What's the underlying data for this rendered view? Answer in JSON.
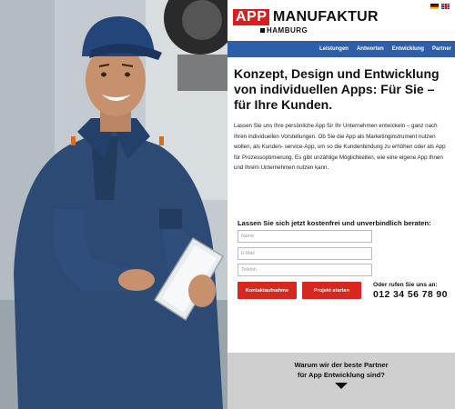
{
  "brand": {
    "logo_app": "APP",
    "logo_main": "MANUFAKTUR",
    "logo_sub": "HAMBURG"
  },
  "language_flags": [
    "flag-de-icon",
    "flag-en-icon"
  ],
  "nav": {
    "items": [
      {
        "label": "Leistungen"
      },
      {
        "label": "Antworten"
      },
      {
        "label": "Entwicklung"
      },
      {
        "label": "Partner"
      }
    ]
  },
  "hero": {
    "headline": "Konzept, Design und Entwicklung von individuellen Apps: Für Sie – für Ihre Kunden.",
    "intro": "Lassen Sie uns Ihre persönliche App für Ihr Unternehmen entwickeln – ganz nach Ihren individuellen Vorstellungen. Ob Sie die App als Marketinginstrument nutzen wollen, als Kunden- service-App, um so die Kundenbindung zu erhöhen oder als App für Prozessoptimierung. Es gibt unzählige Möglichkeiten, wie eine eigene App Ihnen und Ihrem Unternehmen nutzen kann."
  },
  "contact_form": {
    "title": "Lassen Sie sich jetzt kostenfrei und unverbindlich beraten:",
    "name_placeholder": "Name",
    "email_placeholder": "E-Mail",
    "phone_placeholder": "Telefon",
    "contact_button": "Kontaktaufnahme",
    "project_button": "Projekt starten",
    "call_label": "Oder rufen Sie uns an:",
    "call_number": "012 34 56 78 90"
  },
  "partner_section": {
    "line1": "Warum wir der beste Partner",
    "line2": "für App Entwicklung sind?"
  },
  "colors": {
    "accent_red": "#d72820",
    "nav_blue": "#2e5ea8",
    "panel_gray": "#cfcfcf"
  }
}
